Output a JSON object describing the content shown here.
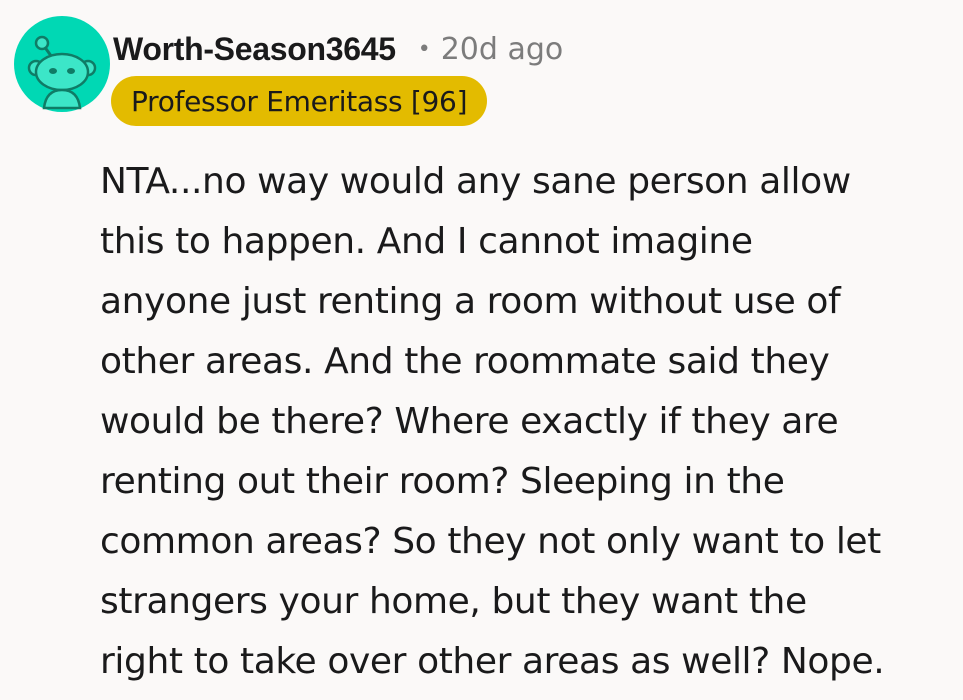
{
  "comment": {
    "author": "Worth-Season3645",
    "separator": "•",
    "timestamp": "20d ago",
    "flair": "Professor Emeritass [96]",
    "avatar_icon": "snoo-avatar-icon",
    "colors": {
      "background": "#fbf9f8",
      "avatar_bg": "#00d8b4",
      "flair_bg": "#e3bb00",
      "text": "#1a1a1b",
      "meta": "#7c7c7c"
    },
    "body_lines": [
      "NTA...no way would any sane person allow",
      "this to happen. And I cannot imagine",
      "anyone just renting a room without use of",
      "other areas. And the roommate said they",
      "would be there? Where exactly if they are",
      "renting out their room? Sleeping in the",
      "common areas? So they not only want to let",
      "strangers your home, but they want the",
      "right to take over other areas as well? Nope."
    ]
  }
}
